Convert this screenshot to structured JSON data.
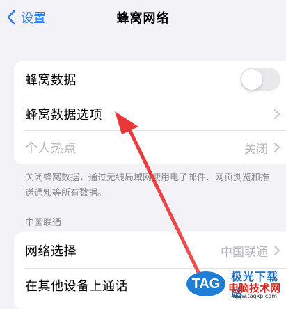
{
  "nav": {
    "back_label": "设置",
    "title": "蜂窝网络"
  },
  "group1": {
    "rows": [
      {
        "label": "蜂窝数据",
        "toggle": "off"
      },
      {
        "label": "蜂窝数据选项"
      },
      {
        "label": "个人热点",
        "value": "关闭"
      }
    ]
  },
  "footnote": "关闭蜂窝数据，通过无线局域网使用电子邮件、网页浏览和推送通知等所有数据。",
  "carrier": {
    "header": "中国联通",
    "rows": [
      {
        "label": "网络选择",
        "value": "中国联通"
      },
      {
        "label": "在其他设备上通话"
      }
    ]
  },
  "watermark": {
    "tag": "TAG",
    "line1": "极光下载站",
    "line2": "电脑技术网",
    "url": "www.tagxp.com"
  },
  "colors": {
    "accent": "#2f7cf6",
    "background": "#f2f2f7",
    "arrow": "#e8383a"
  }
}
